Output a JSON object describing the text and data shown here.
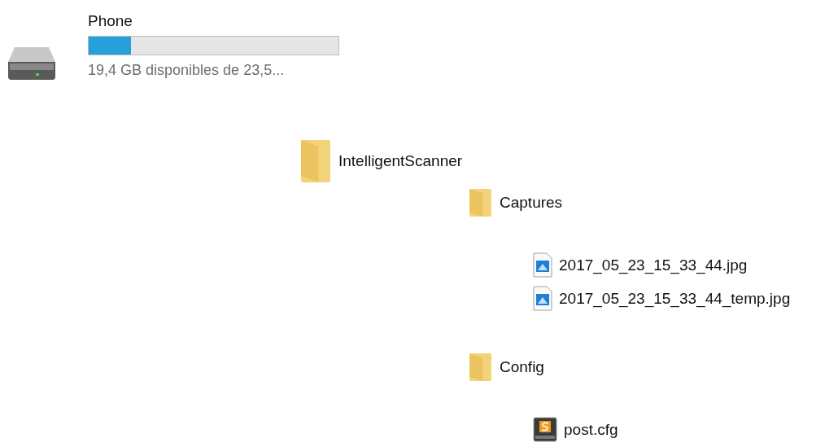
{
  "drive": {
    "name": "Phone",
    "level": 0.17,
    "free_space": "19,4 GB disponibles de 23,5..."
  },
  "tree": [
    {
      "kind": "folder",
      "name": "IntelligentScanner",
      "children": [
        {
          "kind": "folder",
          "name": "Captures",
          "children": [
            {
              "kind": "image",
              "name": "2017_05_23_15_33_44.jpg"
            },
            {
              "kind": "image",
              "name": "2017_05_23_15_33_44_temp.jpg"
            }
          ]
        },
        {
          "kind": "folder",
          "name": "Config",
          "children": [
            {
              "kind": "config",
              "name": "post.cfg"
            }
          ]
        }
      ]
    }
  ]
}
